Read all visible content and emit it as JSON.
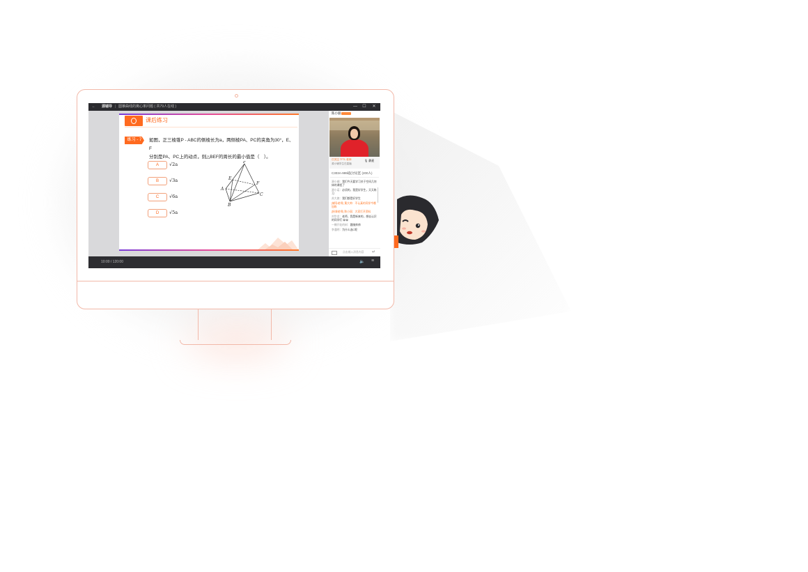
{
  "window": {
    "back": "←",
    "app_name": "源辅导",
    "course_title": "圆锥曲线的离心率问题 ( 共79人在线 )",
    "controls": [
      "—",
      "☐",
      "✕"
    ]
  },
  "slide": {
    "section_title": "课后练习",
    "question_tag": "练习 - 7",
    "question_line1": "如图，正三棱锥P - ABC的侧棱长为a，两侧棱PA、PC的夹角为30°，E、F",
    "question_line2": "分别是PA、PC上的动点，则△BEF的周长的最小值是（　）。",
    "options": [
      {
        "label": "A",
        "value": "√2a"
      },
      {
        "label": "B",
        "value": "√3a"
      },
      {
        "label": "C",
        "value": "√6a"
      },
      {
        "label": "D",
        "value": "√5a"
      }
    ],
    "figure_labels": {
      "P": "P",
      "A": "A",
      "B": "B",
      "C": "C",
      "E": "E",
      "F": "F"
    }
  },
  "sidebar": {
    "teacher_name": "陈小丽",
    "teacher_info": "已关注 TFTL 老师",
    "teacher_sub": "源小辅学生在直播",
    "mic_label": "静麦",
    "room_info": "C303A-999班(讨论区 (200人)",
    "messages": [
      {
        "user": "源小辅：",
        "text": "我们今天要学习关于空间几何体的课程了",
        "highlight": false
      },
      {
        "user": "源小诺：",
        "text": "必须的，我是好学生，天天练习",
        "highlight": false
      },
      {
        "user": "苏大旗：",
        "text": "我们都是好学生",
        "highlight": false
      },
      {
        "user": "[辅导老师] 黄大帅：",
        "text": "不认真的同学今晚加练",
        "highlight": true
      },
      {
        "user": "[授课老师] 陈小丽：",
        "text": "大家打开资料",
        "highlight": true
      },
      {
        "user": "刘华龙：",
        "text": "老师，我是新来的，想去认识的同学们 😀😀",
        "highlight": false
      },
      {
        "user": "一棵开花的树：",
        "text": "跟随帅帅",
        "highlight": false
      },
      {
        "user": "李通明：",
        "text": "为什么选C呢",
        "highlight": false
      }
    ],
    "input_placeholder": "点击输入消息内容"
  },
  "player": {
    "time": "10:00 / 120:00"
  },
  "colors": {
    "accent": "#ff6a1f",
    "monitor_outline": "#f2b8a8"
  }
}
